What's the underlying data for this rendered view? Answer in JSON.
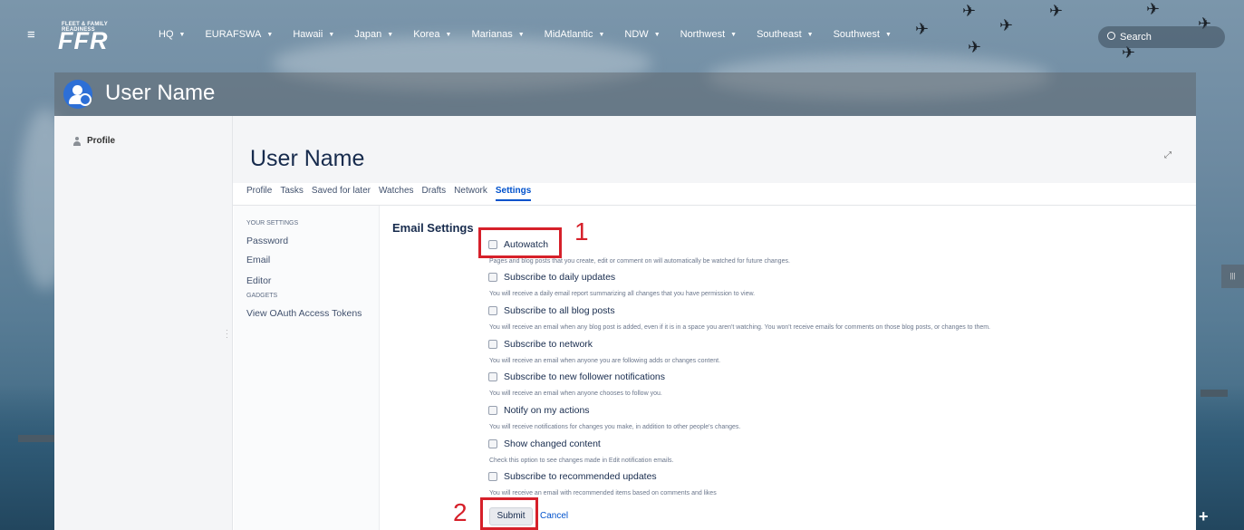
{
  "nav": {
    "logo_tagline": "FLEET & FAMILY READINESS",
    "logo_text": "FFR",
    "items": [
      {
        "label": "HQ"
      },
      {
        "label": "EURAFSWA"
      },
      {
        "label": "Hawaii"
      },
      {
        "label": "Japan"
      },
      {
        "label": "Korea"
      },
      {
        "label": "Marianas"
      },
      {
        "label": "MidAtlantic"
      },
      {
        "label": "NDW"
      },
      {
        "label": "Northwest"
      },
      {
        "label": "Southeast"
      },
      {
        "label": "Southwest"
      }
    ],
    "search_placeholder": "Search"
  },
  "header": {
    "title": "User Name"
  },
  "sidebar": {
    "profile_label": "Profile"
  },
  "main": {
    "title": "User Name",
    "tabs": [
      {
        "label": "Profile"
      },
      {
        "label": "Tasks"
      },
      {
        "label": "Saved for later"
      },
      {
        "label": "Watches"
      },
      {
        "label": "Drafts"
      },
      {
        "label": "Network"
      },
      {
        "label": "Settings",
        "active": true
      }
    ]
  },
  "settings_nav": {
    "your_settings_heading": "YOUR SETTINGS",
    "password": "Password",
    "email": "Email",
    "editor": "Editor",
    "gadgets_heading": "GADGETS",
    "oauth": "View OAuth Access Tokens"
  },
  "email_settings": {
    "title": "Email Settings",
    "options": [
      {
        "label": "Autowatch",
        "desc": "Pages and blog posts that you create, edit or comment on will automatically be watched for future changes.",
        "checked": false
      },
      {
        "label": "Subscribe to daily updates",
        "desc": "You will receive a daily email report summarizing all changes that you have permission to view.",
        "checked": false
      },
      {
        "label": "Subscribe to all blog posts",
        "desc": "You will receive an email when any blog post is added, even if it is in a space you aren't watching. You won't receive emails for comments on those blog posts, or changes to them.",
        "checked": false
      },
      {
        "label": "Subscribe to network",
        "desc": "You will receive an email when anyone you are following adds or changes content.",
        "checked": false
      },
      {
        "label": "Subscribe to new follower notifications",
        "desc": "You will receive an email when anyone chooses to follow you.",
        "checked": false
      },
      {
        "label": "Notify on my actions",
        "desc": "You will receive notifications for changes you make, in addition to other people's changes.",
        "checked": false
      },
      {
        "label": "Show changed content",
        "desc": "Check this option to see changes made in Edit notification emails.",
        "checked": false
      },
      {
        "label": "Subscribe to recommended updates",
        "desc": "You will receive an email with recommended items based on comments and likes",
        "checked": false
      }
    ],
    "submit_label": "Submit",
    "cancel_label": "Cancel"
  },
  "annotations": {
    "step1": "1",
    "step2": "2",
    "color": "#d6202a"
  },
  "right_handle_label": "|||",
  "plus_label": "+"
}
